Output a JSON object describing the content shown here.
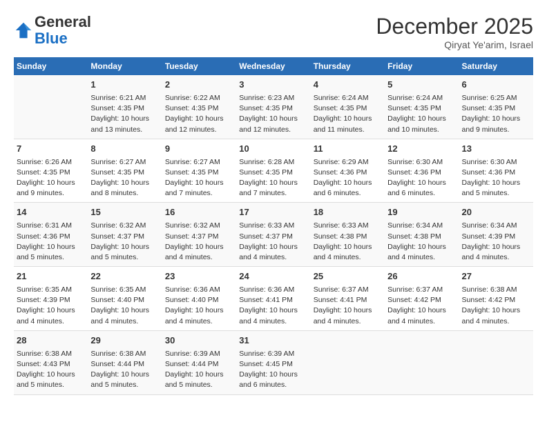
{
  "header": {
    "logo_general": "General",
    "logo_blue": "Blue",
    "month": "December 2025",
    "location": "Qiryat Ye'arim, Israel"
  },
  "weekdays": [
    "Sunday",
    "Monday",
    "Tuesday",
    "Wednesday",
    "Thursday",
    "Friday",
    "Saturday"
  ],
  "weeks": [
    [
      {
        "day": "",
        "info": ""
      },
      {
        "day": "1",
        "info": "Sunrise: 6:21 AM\nSunset: 4:35 PM\nDaylight: 10 hours\nand 13 minutes."
      },
      {
        "day": "2",
        "info": "Sunrise: 6:22 AM\nSunset: 4:35 PM\nDaylight: 10 hours\nand 12 minutes."
      },
      {
        "day": "3",
        "info": "Sunrise: 6:23 AM\nSunset: 4:35 PM\nDaylight: 10 hours\nand 12 minutes."
      },
      {
        "day": "4",
        "info": "Sunrise: 6:24 AM\nSunset: 4:35 PM\nDaylight: 10 hours\nand 11 minutes."
      },
      {
        "day": "5",
        "info": "Sunrise: 6:24 AM\nSunset: 4:35 PM\nDaylight: 10 hours\nand 10 minutes."
      },
      {
        "day": "6",
        "info": "Sunrise: 6:25 AM\nSunset: 4:35 PM\nDaylight: 10 hours\nand 9 minutes."
      }
    ],
    [
      {
        "day": "7",
        "info": "Sunrise: 6:26 AM\nSunset: 4:35 PM\nDaylight: 10 hours\nand 9 minutes."
      },
      {
        "day": "8",
        "info": "Sunrise: 6:27 AM\nSunset: 4:35 PM\nDaylight: 10 hours\nand 8 minutes."
      },
      {
        "day": "9",
        "info": "Sunrise: 6:27 AM\nSunset: 4:35 PM\nDaylight: 10 hours\nand 7 minutes."
      },
      {
        "day": "10",
        "info": "Sunrise: 6:28 AM\nSunset: 4:35 PM\nDaylight: 10 hours\nand 7 minutes."
      },
      {
        "day": "11",
        "info": "Sunrise: 6:29 AM\nSunset: 4:36 PM\nDaylight: 10 hours\nand 6 minutes."
      },
      {
        "day": "12",
        "info": "Sunrise: 6:30 AM\nSunset: 4:36 PM\nDaylight: 10 hours\nand 6 minutes."
      },
      {
        "day": "13",
        "info": "Sunrise: 6:30 AM\nSunset: 4:36 PM\nDaylight: 10 hours\nand 5 minutes."
      }
    ],
    [
      {
        "day": "14",
        "info": "Sunrise: 6:31 AM\nSunset: 4:36 PM\nDaylight: 10 hours\nand 5 minutes."
      },
      {
        "day": "15",
        "info": "Sunrise: 6:32 AM\nSunset: 4:37 PM\nDaylight: 10 hours\nand 5 minutes."
      },
      {
        "day": "16",
        "info": "Sunrise: 6:32 AM\nSunset: 4:37 PM\nDaylight: 10 hours\nand 4 minutes."
      },
      {
        "day": "17",
        "info": "Sunrise: 6:33 AM\nSunset: 4:37 PM\nDaylight: 10 hours\nand 4 minutes."
      },
      {
        "day": "18",
        "info": "Sunrise: 6:33 AM\nSunset: 4:38 PM\nDaylight: 10 hours\nand 4 minutes."
      },
      {
        "day": "19",
        "info": "Sunrise: 6:34 AM\nSunset: 4:38 PM\nDaylight: 10 hours\nand 4 minutes."
      },
      {
        "day": "20",
        "info": "Sunrise: 6:34 AM\nSunset: 4:39 PM\nDaylight: 10 hours\nand 4 minutes."
      }
    ],
    [
      {
        "day": "21",
        "info": "Sunrise: 6:35 AM\nSunset: 4:39 PM\nDaylight: 10 hours\nand 4 minutes."
      },
      {
        "day": "22",
        "info": "Sunrise: 6:35 AM\nSunset: 4:40 PM\nDaylight: 10 hours\nand 4 minutes."
      },
      {
        "day": "23",
        "info": "Sunrise: 6:36 AM\nSunset: 4:40 PM\nDaylight: 10 hours\nand 4 minutes."
      },
      {
        "day": "24",
        "info": "Sunrise: 6:36 AM\nSunset: 4:41 PM\nDaylight: 10 hours\nand 4 minutes."
      },
      {
        "day": "25",
        "info": "Sunrise: 6:37 AM\nSunset: 4:41 PM\nDaylight: 10 hours\nand 4 minutes."
      },
      {
        "day": "26",
        "info": "Sunrise: 6:37 AM\nSunset: 4:42 PM\nDaylight: 10 hours\nand 4 minutes."
      },
      {
        "day": "27",
        "info": "Sunrise: 6:38 AM\nSunset: 4:42 PM\nDaylight: 10 hours\nand 4 minutes."
      }
    ],
    [
      {
        "day": "28",
        "info": "Sunrise: 6:38 AM\nSunset: 4:43 PM\nDaylight: 10 hours\nand 5 minutes."
      },
      {
        "day": "29",
        "info": "Sunrise: 6:38 AM\nSunset: 4:44 PM\nDaylight: 10 hours\nand 5 minutes."
      },
      {
        "day": "30",
        "info": "Sunrise: 6:39 AM\nSunset: 4:44 PM\nDaylight: 10 hours\nand 5 minutes."
      },
      {
        "day": "31",
        "info": "Sunrise: 6:39 AM\nSunset: 4:45 PM\nDaylight: 10 hours\nand 6 minutes."
      },
      {
        "day": "",
        "info": ""
      },
      {
        "day": "",
        "info": ""
      },
      {
        "day": "",
        "info": ""
      }
    ]
  ]
}
